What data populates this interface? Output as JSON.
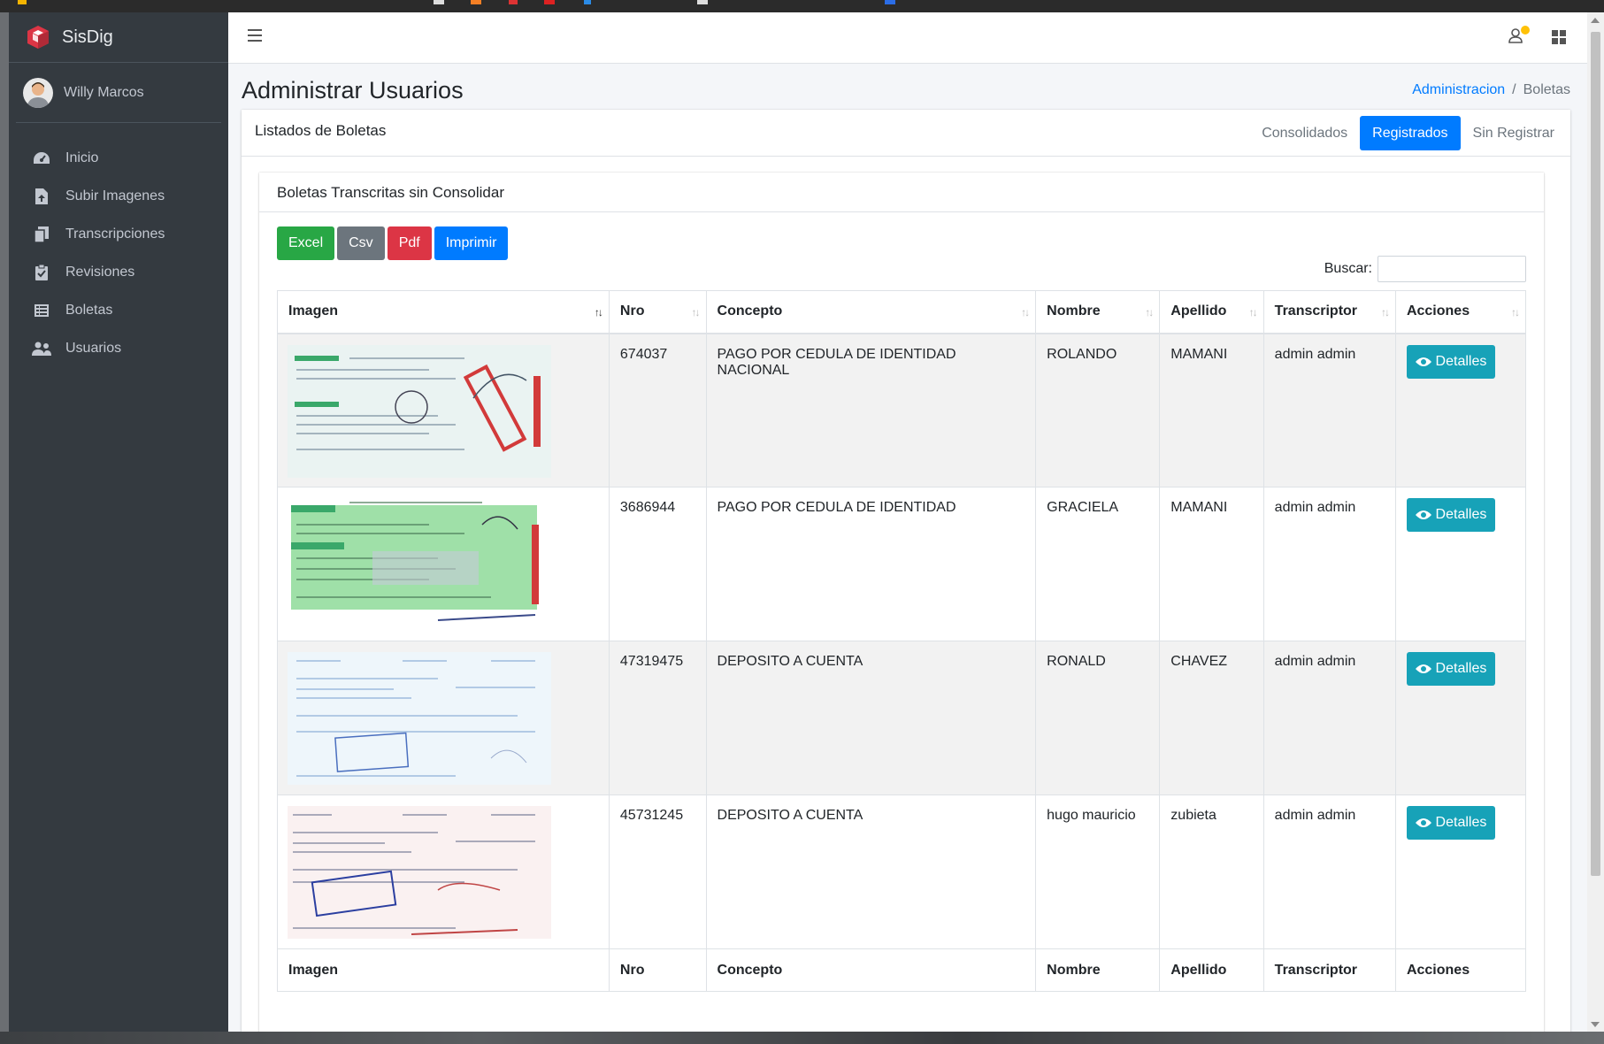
{
  "app": {
    "brand": "SisDig",
    "user": "Willy Marcos"
  },
  "sidebar": {
    "items": [
      {
        "label": "Inicio",
        "icon": "dashboard-icon"
      },
      {
        "label": "Subir Imagenes",
        "icon": "file-upload-icon"
      },
      {
        "label": "Transcripciones",
        "icon": "copy-icon"
      },
      {
        "label": "Revisiones",
        "icon": "clipboard-check-icon"
      },
      {
        "label": "Boletas",
        "icon": "list-icon"
      },
      {
        "label": "Usuarios",
        "icon": "users-icon"
      }
    ]
  },
  "header": {
    "title": "Administrar Usuarios",
    "breadcrumb": {
      "link": "Administracion",
      "separator": "/",
      "current": "Boletas"
    }
  },
  "card": {
    "title": "Listados de Boletas",
    "tabs": {
      "consolidados": "Consolidados",
      "registrados": "Registrados",
      "sin_registrar": "Sin Registrar"
    },
    "active_tab": "Registrados"
  },
  "inner": {
    "title": "Boletas Transcritas sin Consolidar",
    "buttons": {
      "excel": "Excel",
      "csv": "Csv",
      "pdf": "Pdf",
      "print": "Imprimir"
    },
    "search_label": "Buscar:",
    "search_value": ""
  },
  "table": {
    "columns": {
      "imagen": "Imagen",
      "nro": "Nro",
      "concepto": "Concepto",
      "nombre": "Nombre",
      "apellido": "Apellido",
      "transcriptor": "Transcriptor",
      "acciones": "Acciones"
    },
    "details_label": "Detalles",
    "rows": [
      {
        "nro": "674037",
        "concepto": "PAGO POR CEDULA DE IDENTIDAD NACIONAL",
        "nombre": "ROLANDO",
        "apellido": "MAMANI",
        "transcriptor": "admin admin"
      },
      {
        "nro": "3686944",
        "concepto": "PAGO POR CEDULA DE IDENTIDAD",
        "nombre": "GRACIELA",
        "apellido": "MAMANI",
        "transcriptor": "admin admin"
      },
      {
        "nro": "47319475",
        "concepto": "DEPOSITO A CUENTA",
        "nombre": "RONALD",
        "apellido": "CHAVEZ",
        "transcriptor": "admin admin"
      },
      {
        "nro": "45731245",
        "concepto": "DEPOSITO A CUENTA",
        "nombre": "hugo mauricio",
        "apellido": "zubieta",
        "transcriptor": "admin admin"
      }
    ]
  },
  "colors": {
    "primary": "#007bff",
    "sidebar": "#343a40",
    "info": "#17a2b8",
    "success": "#28a745",
    "danger": "#dc3545",
    "secondary": "#6c757d"
  }
}
